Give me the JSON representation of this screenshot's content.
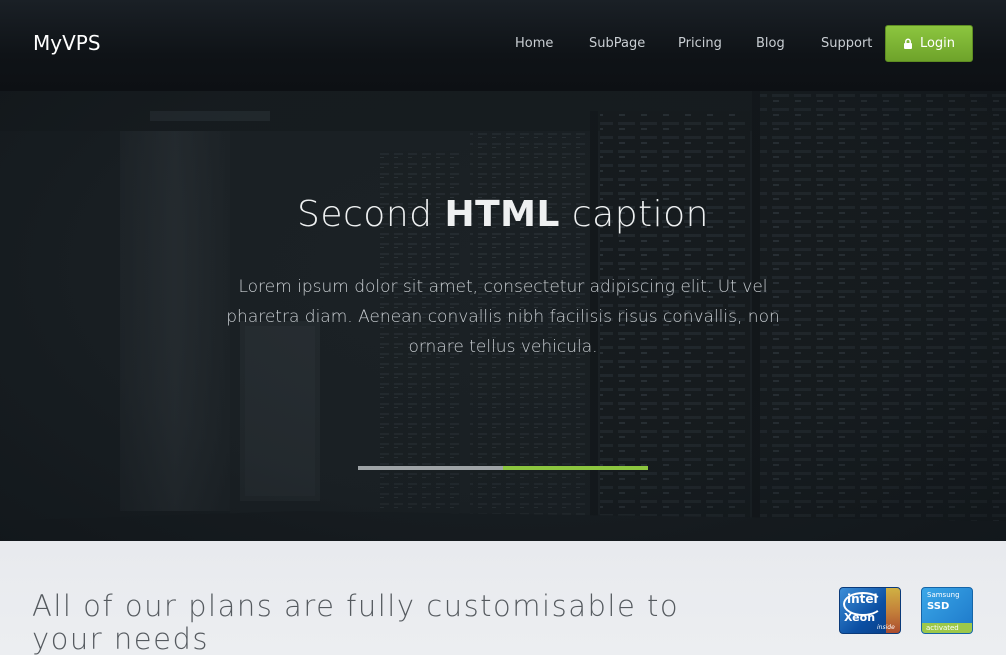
{
  "header": {
    "logo": "MyVPS",
    "nav": [
      {
        "label": "Home"
      },
      {
        "label": "SubPage"
      },
      {
        "label": "Pricing"
      },
      {
        "label": "Blog"
      },
      {
        "label": "Support"
      }
    ],
    "login_label": "Login"
  },
  "hero": {
    "title_light_1": "Second ",
    "title_bold": "HTML",
    "title_light_2": " caption",
    "text": "Lorem ipsum dolor sit amet, consectetur adipiscing elit. Ut vel pharetra diam. Aenean convallis nibh facilisis risus convallis, non ornare tellus vehicula.",
    "slider_progress": 0.5
  },
  "features": {
    "heading": "All of our plans are fully customisable to your needs",
    "badges": {
      "intel_brand": "intel",
      "intel_product": "Xeon",
      "intel_suffix": "inside",
      "ssd_brand": "Samsung",
      "ssd_product": "SSD",
      "ssd_status": "activated"
    }
  },
  "colors": {
    "accent": "#8cc63f",
    "header_bg": "#0f1317",
    "hero_bg": "#1d2327",
    "section_bg": "#e9ebef"
  },
  "icons": {
    "login": "lock-icon"
  }
}
